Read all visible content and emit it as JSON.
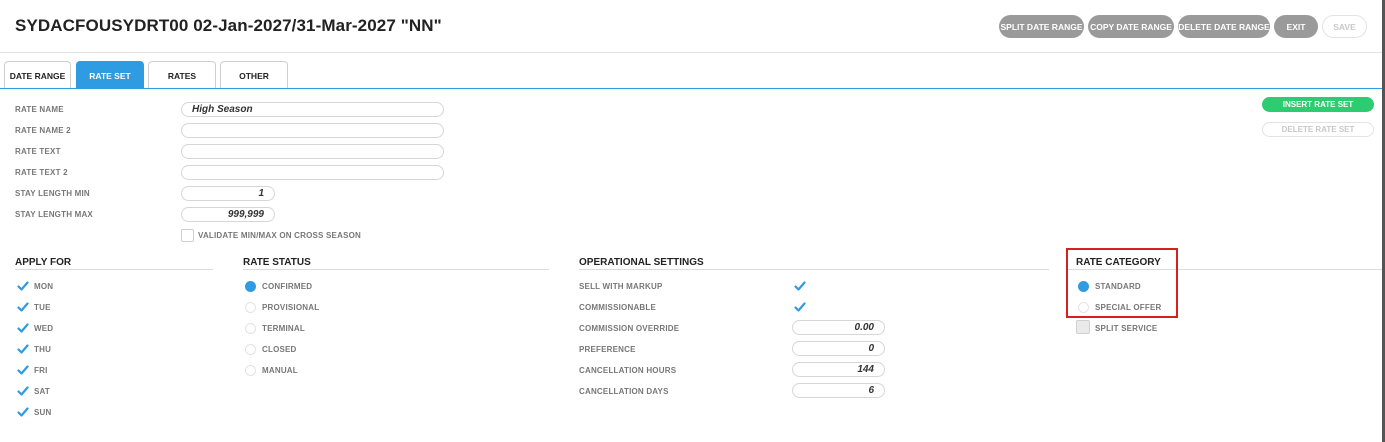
{
  "window": {
    "title": "SYDACFOUSYDRT00 02-Jan-2027/31-Mar-2027 \"NN\""
  },
  "toolbar": {
    "split_date_range": "SPLIT DATE RANGE",
    "copy_date_range": "COPY DATE RANGE",
    "delete_date_range": "DELETE DATE RANGE",
    "exit": "EXIT",
    "save": "SAVE"
  },
  "tabs": [
    {
      "label": "DATE RANGE"
    },
    {
      "label": "RATE SET"
    },
    {
      "label": "RATES"
    },
    {
      "label": "OTHER"
    }
  ],
  "form": {
    "rate_name_label": "RATE NAME",
    "rate_name_value": "High Season",
    "rate_name2_label": "RATE NAME 2",
    "rate_name2_value": "",
    "rate_text_label": "RATE TEXT",
    "rate_text_value": "",
    "rate_text2_label": "RATE TEXT 2",
    "rate_text2_value": "",
    "stay_min_label": "STAY LENGTH MIN",
    "stay_min_value": "1",
    "stay_max_label": "STAY LENGTH MAX",
    "stay_max_value": "999,999",
    "validate_label": "VALIDATE MIN/MAX ON CROSS SEASON"
  },
  "side_buttons": {
    "insert": "INSERT RATE SET",
    "delete": "DELETE RATE SET"
  },
  "apply_for": {
    "title": "APPLY FOR",
    "days": [
      "MON",
      "TUE",
      "WED",
      "THU",
      "FRI",
      "SAT",
      "SUN"
    ]
  },
  "rate_status": {
    "title": "RATE STATUS",
    "options": [
      "CONFIRMED",
      "PROVISIONAL",
      "TERMINAL",
      "CLOSED",
      "MANUAL"
    ],
    "selected": "CONFIRMED"
  },
  "operational": {
    "title": "OPERATIONAL SETTINGS",
    "sell_with_markup": "SELL WITH MARKUP",
    "commissionable": "COMMISSIONABLE",
    "commission_override_label": "COMMISSION OVERRIDE",
    "commission_override_value": "0.00",
    "preference_label": "PREFERENCE",
    "preference_value": "0",
    "cancel_hours_label": "CANCELLATION HOURS",
    "cancel_hours_value": "144",
    "cancel_days_label": "CANCELLATION DAYS",
    "cancel_days_value": "6"
  },
  "rate_category": {
    "title": "RATE CATEGORY",
    "standard": "STANDARD",
    "special_offer": "SPECIAL OFFER",
    "split_service": "SPLIT SERVICE",
    "selected": "STANDARD"
  },
  "colors": {
    "accent": "#2f9be0",
    "green": "#2ecc71",
    "highlight": "#d62020"
  },
  "icons": {
    "check": "check-icon"
  }
}
